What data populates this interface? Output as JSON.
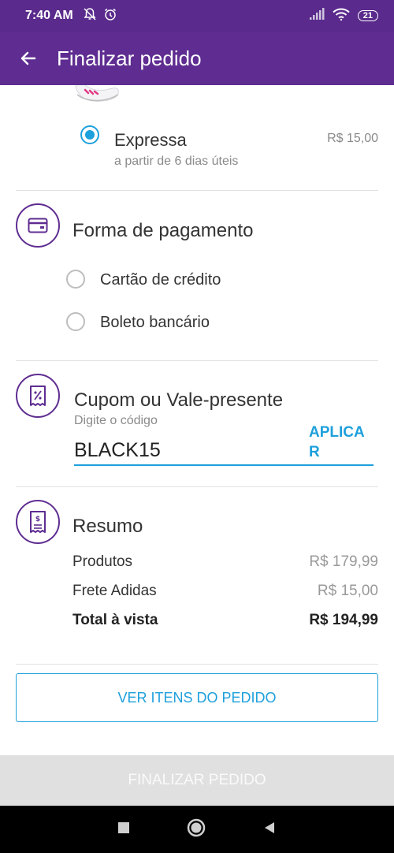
{
  "status_bar": {
    "time": "7:40 AM",
    "battery": "21",
    "icons": [
      "notifications-off-icon",
      "alarm-icon",
      "signal-icon",
      "wifi-icon",
      "battery-icon"
    ]
  },
  "app_bar": {
    "back_icon": "arrow-left-icon",
    "title": "Finalizar pedido"
  },
  "shipping": {
    "option_label": "Expressa",
    "option_desc": "a partir de 6 dias úteis",
    "option_price": "R$ 15,00",
    "selected": true
  },
  "payment": {
    "title": "Forma de pagamento",
    "icon": "credit-card-icon",
    "options": [
      "Cartão de crédito",
      "Boleto bancário"
    ]
  },
  "coupon": {
    "title": "Cupom ou Vale-presente",
    "icon": "discount-ticket-icon",
    "hint": "Digite o código",
    "value": "BLACK15",
    "apply_line1": "APLICA",
    "apply_line2": "R"
  },
  "summary": {
    "title": "Resumo",
    "icon": "receipt-icon",
    "rows": [
      {
        "label": "Produtos",
        "value": "R$ 179,99"
      },
      {
        "label": "Frete Adidas",
        "value": "R$ 15,00"
      }
    ],
    "total_label": "Total à vista",
    "total_value": "R$ 194,99"
  },
  "buttons": {
    "view_items": "VER ITENS DO PEDIDO",
    "finalize": "FINALIZAR PEDIDO"
  },
  "colors": {
    "primary_purple": "#5f2d91",
    "accent_blue": "#1ea0dc",
    "disabled_gray": "#e0e0e0"
  },
  "nav_bar": {
    "icons": [
      "recent-apps-icon",
      "home-icon",
      "back-icon"
    ]
  }
}
